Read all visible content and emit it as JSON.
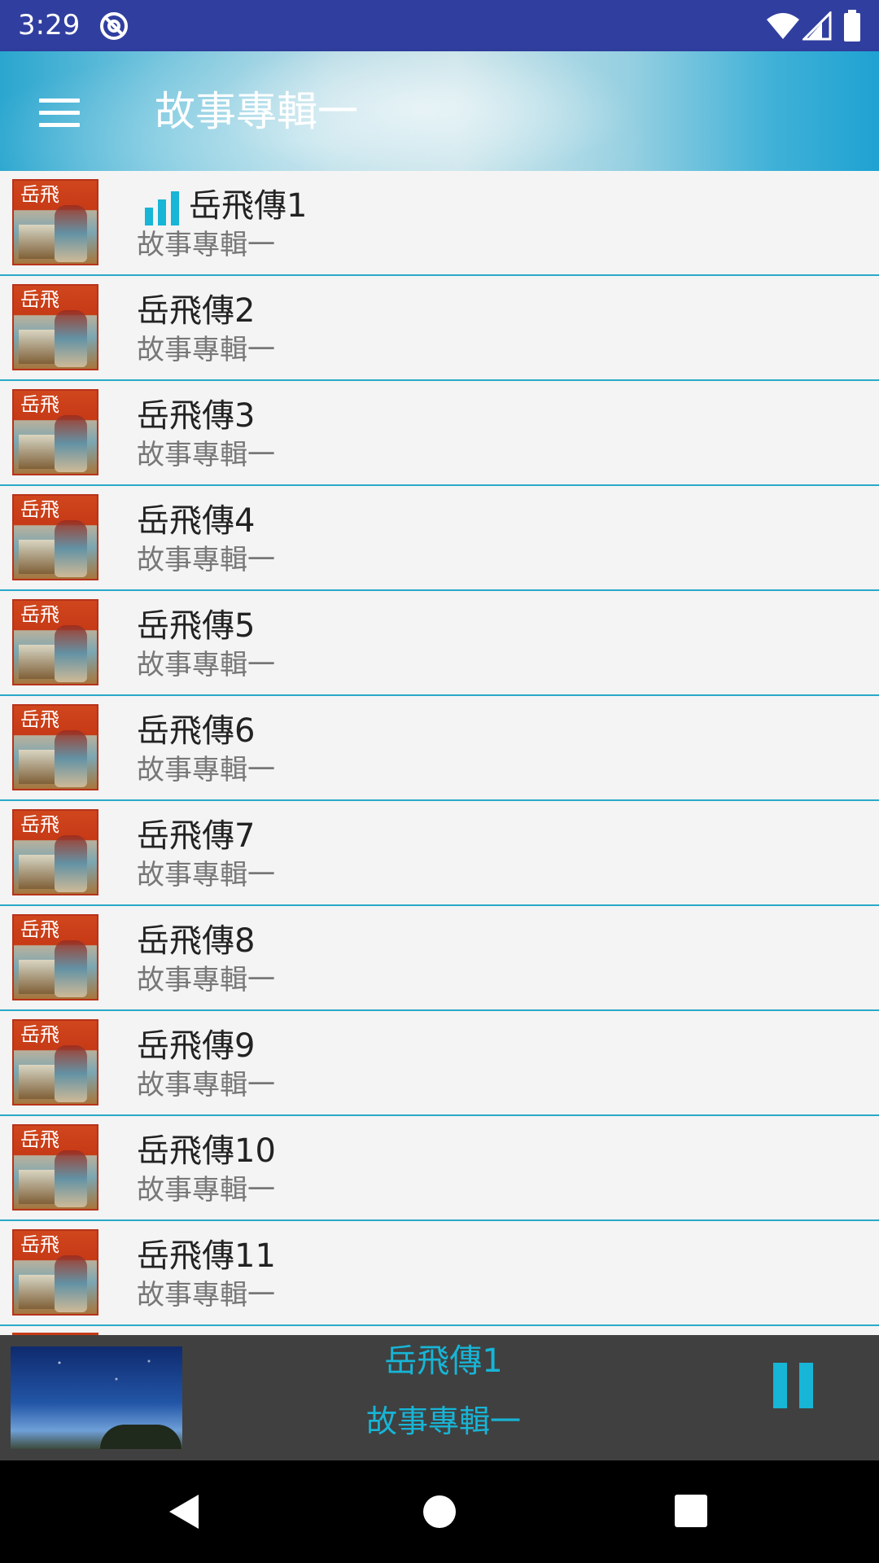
{
  "status_bar": {
    "time": "3:29",
    "icons": [
      "do-not-disturb-icon",
      "wifi-icon",
      "signal-icon",
      "battery-icon"
    ]
  },
  "app_bar": {
    "title": "故事專輯一",
    "menu_icon": "menu-icon"
  },
  "list": {
    "items": [
      {
        "title": "岳飛傳1",
        "subtitle": "故事專輯一",
        "playing": true
      },
      {
        "title": "岳飛傳2",
        "subtitle": "故事專輯一"
      },
      {
        "title": "岳飛傳3",
        "subtitle": "故事專輯一"
      },
      {
        "title": "岳飛傳4",
        "subtitle": "故事專輯一"
      },
      {
        "title": "岳飛傳5",
        "subtitle": "故事專輯一"
      },
      {
        "title": "岳飛傳6",
        "subtitle": "故事專輯一"
      },
      {
        "title": "岳飛傳7",
        "subtitle": "故事專輯一"
      },
      {
        "title": "岳飛傳8",
        "subtitle": "故事專輯一"
      },
      {
        "title": "岳飛傳9",
        "subtitle": "故事專輯一"
      },
      {
        "title": "岳飛傳10",
        "subtitle": "故事專輯一"
      },
      {
        "title": "岳飛傳11",
        "subtitle": "故事專輯一"
      }
    ],
    "thumb_text": "岳飛",
    "playing_icon": "equalizer-icon"
  },
  "now_playing": {
    "title": "岳飛傳1",
    "subtitle": "故事專輯一",
    "control_icon": "pause-icon"
  },
  "nav_bar": {
    "icons": [
      "back-icon",
      "home-icon",
      "recents-icon"
    ]
  },
  "colors": {
    "status_bar": "#303f9f",
    "accent": "#17b5d6",
    "divider": "#29a9c8",
    "list_bg": "#f4f4f4",
    "player_bg": "#404040"
  }
}
